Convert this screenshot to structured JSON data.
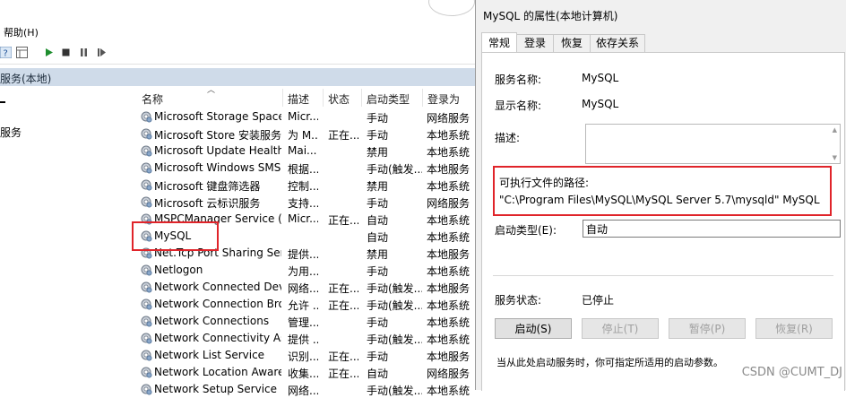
{
  "services_window": {
    "menu_help": "帮助(H)",
    "left_pane_title": "服务(本地)",
    "left_pane_item": "服务",
    "columns": [
      "名称",
      "描述",
      "状态",
      "启动类型",
      "登录为"
    ],
    "rows": [
      {
        "name": "Microsoft Storage Space...",
        "desc": "Micr...",
        "status": "",
        "type": "手动",
        "logon": "网络服务"
      },
      {
        "name": "Microsoft Store 安装服务",
        "desc": "为 M...",
        "status": "正在...",
        "type": "手动",
        "logon": "本地系统"
      },
      {
        "name": "Microsoft Update Health...",
        "desc": "Mai...",
        "status": "",
        "type": "禁用",
        "logon": "本地系统"
      },
      {
        "name": "Microsoft Windows SMS ...",
        "desc": "根据...",
        "status": "",
        "type": "手动(触发...",
        "logon": "本地服务"
      },
      {
        "name": "Microsoft 键盘筛选器",
        "desc": "控制...",
        "status": "",
        "type": "禁用",
        "logon": "本地系统"
      },
      {
        "name": "Microsoft 云标识服务",
        "desc": "支持...",
        "status": "",
        "type": "手动",
        "logon": "网络服务"
      },
      {
        "name": "MSPCManager Service (S...",
        "desc": "Micr...",
        "status": "正在...",
        "type": "自动",
        "logon": "本地系统"
      },
      {
        "name": "MySQL",
        "desc": "",
        "status": "",
        "type": "自动",
        "logon": "本地系统"
      },
      {
        "name": "Net.Tcp Port Sharing Ser...",
        "desc": "提供...",
        "status": "",
        "type": "禁用",
        "logon": "本地服务"
      },
      {
        "name": "Netlogon",
        "desc": "为用...",
        "status": "",
        "type": "手动",
        "logon": "本地系统"
      },
      {
        "name": "Network Connected Devi...",
        "desc": "网络...",
        "status": "正在...",
        "type": "手动(触发...",
        "logon": "本地服务"
      },
      {
        "name": "Network Connection Bro...",
        "desc": "允许 ...",
        "status": "正在...",
        "type": "手动(触发...",
        "logon": "本地系统"
      },
      {
        "name": "Network Connections",
        "desc": "管理...",
        "status": "",
        "type": "手动",
        "logon": "本地系统"
      },
      {
        "name": "Network Connectivity Ass...",
        "desc": "提供 ...",
        "status": "",
        "type": "手动(触发...",
        "logon": "本地系统"
      },
      {
        "name": "Network List Service",
        "desc": "识别...",
        "status": "正在...",
        "type": "手动",
        "logon": "本地服务"
      },
      {
        "name": "Network Location Aware...",
        "desc": "收集...",
        "status": "正在...",
        "type": "自动",
        "logon": "网络服务"
      },
      {
        "name": "Network Setup Service",
        "desc": "网络...",
        "status": "",
        "type": "手动(触发...",
        "logon": "本地系统"
      }
    ]
  },
  "dialog": {
    "title": "MySQL 的属性(本地计算机)",
    "tabs": [
      "常规",
      "登录",
      "恢复",
      "依存关系"
    ],
    "service_name_label": "服务名称:",
    "service_name": "MySQL",
    "display_name_label": "显示名称:",
    "display_name": "MySQL",
    "description_label": "描述:",
    "path_label": "可执行文件的路径:",
    "path_value": "\"C:\\Program Files\\MySQL\\MySQL Server 5.7\\mysqld\" MySQL",
    "startup_type_label": "启动类型(E):",
    "startup_type_value": "自动",
    "status_label": "服务状态:",
    "status_value": "已停止",
    "buttons": {
      "start": "启动(S)",
      "stop": "停止(T)",
      "pause": "暂停(P)",
      "resume": "恢复(R)"
    },
    "hint": "当从此处启动服务时，你可指定所适用的启动参数。"
  },
  "watermark": "CSDN @CUMT_DJ",
  "colors": {
    "highlight_box": "#e0242a",
    "pane_header": "#cfdbe9",
    "dialog_bg": "#f0f0f0"
  }
}
